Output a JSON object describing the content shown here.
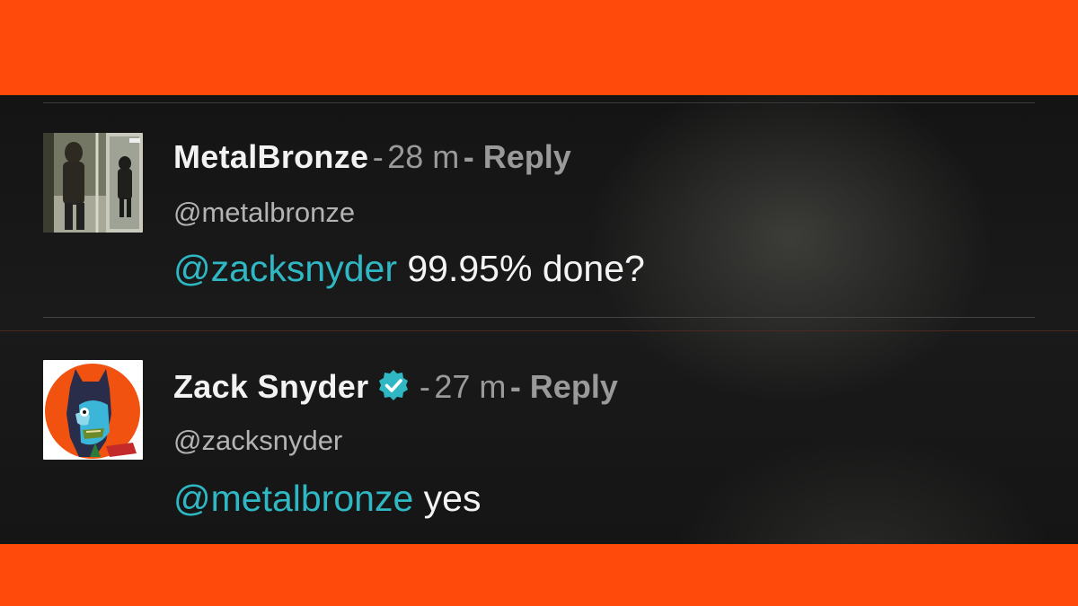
{
  "colors": {
    "frame_orange": "#ff4a0c",
    "mention": "#2fb8c4",
    "verified_badge": "#2fb8c4"
  },
  "comments": [
    {
      "name": "MetalBronze",
      "verified": false,
      "separator": "-",
      "time": "28 m",
      "reply_label": "- Reply",
      "handle": "@metalbronze",
      "mention": "@zacksnyder",
      "text": " 99.95% done?",
      "avatar_icon": "photo-avatar"
    },
    {
      "name": "Zack Snyder",
      "verified": true,
      "verified_icon": "verified-check-icon",
      "separator": "-",
      "time": "27 m",
      "reply_label": "- Reply",
      "handle": "@zacksnyder",
      "mention": "@metalbronze",
      "text": " yes",
      "avatar_icon": "illustrated-batman-avatar"
    }
  ]
}
